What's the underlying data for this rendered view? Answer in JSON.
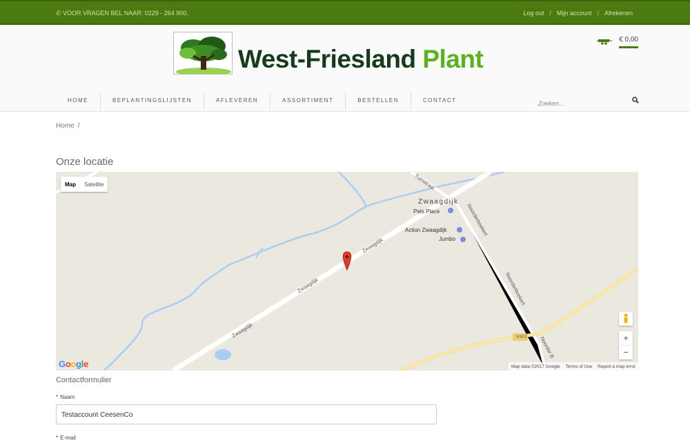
{
  "topbar": {
    "phone": "✆ VOOR VRAGEN BEL NAAR: 0229 - 264 900.",
    "logout": "Log out",
    "account": "Mijn account",
    "checkout": "Afrekenen"
  },
  "brand": {
    "name_part1": "West-Friesland",
    "name_part2": "Plant",
    "color_dark": "#153b1c",
    "color_green": "#5bb120"
  },
  "cart": {
    "icon": "trailer-icon",
    "amount": "€ 0,00"
  },
  "nav": {
    "items": [
      "HOME",
      "BEPLANTINGSLIJSTEN",
      "AFLEVEREN",
      "ASSORTIMENT",
      "BESTELLEN",
      "CONTACT"
    ]
  },
  "search": {
    "placeholder": "Zoeken..."
  },
  "breadcrumb": {
    "home": "Home",
    "sep": "/"
  },
  "page": {
    "title": "Onze locatie"
  },
  "map": {
    "type_map": "Map",
    "type_satellite": "Satellite",
    "town": "Zwaagdijk",
    "pois": [
      "Pets Place",
      "Action Zwaagdijk",
      "Jumbo"
    ],
    "streets": [
      "Tuinstraat",
      "Noorderboekert",
      "Zwaagdijk",
      "N302",
      "Noorder B"
    ],
    "footer": [
      "Map data ©2017 Google",
      "Terms of Use",
      "Report a map error"
    ],
    "zoom_in": "+",
    "zoom_out": "−"
  },
  "form": {
    "title": "Contactformulier",
    "name_label": "Naam",
    "name_value": "Testaccount CeesenCo",
    "email_label": "E-mail",
    "required_mark": "*"
  },
  "colors": {
    "topbar": "#4a7a10",
    "accent": "#4a7a10"
  }
}
